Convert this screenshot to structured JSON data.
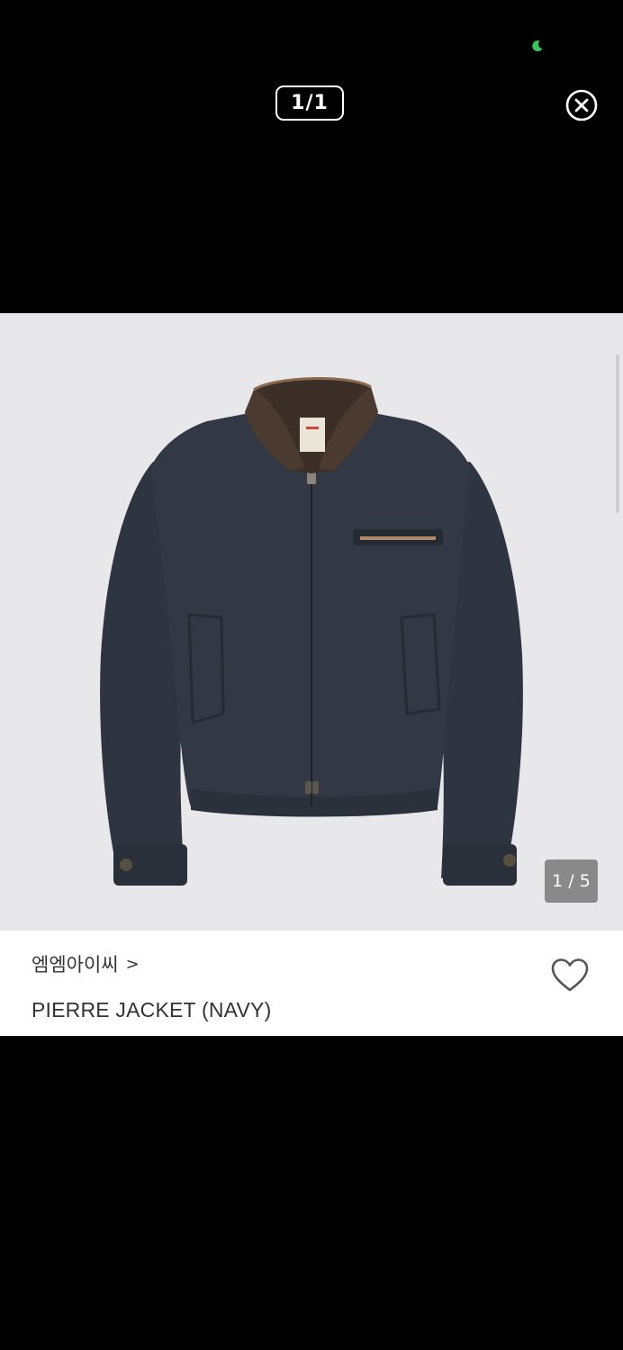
{
  "status_bar": {
    "indicator_icon": "moon-icon",
    "indicator_color": "#34c759"
  },
  "viewer": {
    "counter": "1/1",
    "close_icon": "close-circle-icon"
  },
  "product": {
    "image_alt": "PIERRE JACKET (NAVY)",
    "image_counter": "1 / 5",
    "brand": "엠엠아이씨",
    "brand_chevron": ">",
    "name": "PIERRE JACKET (NAVY)",
    "wishlist_icon": "heart-outline-icon"
  }
}
